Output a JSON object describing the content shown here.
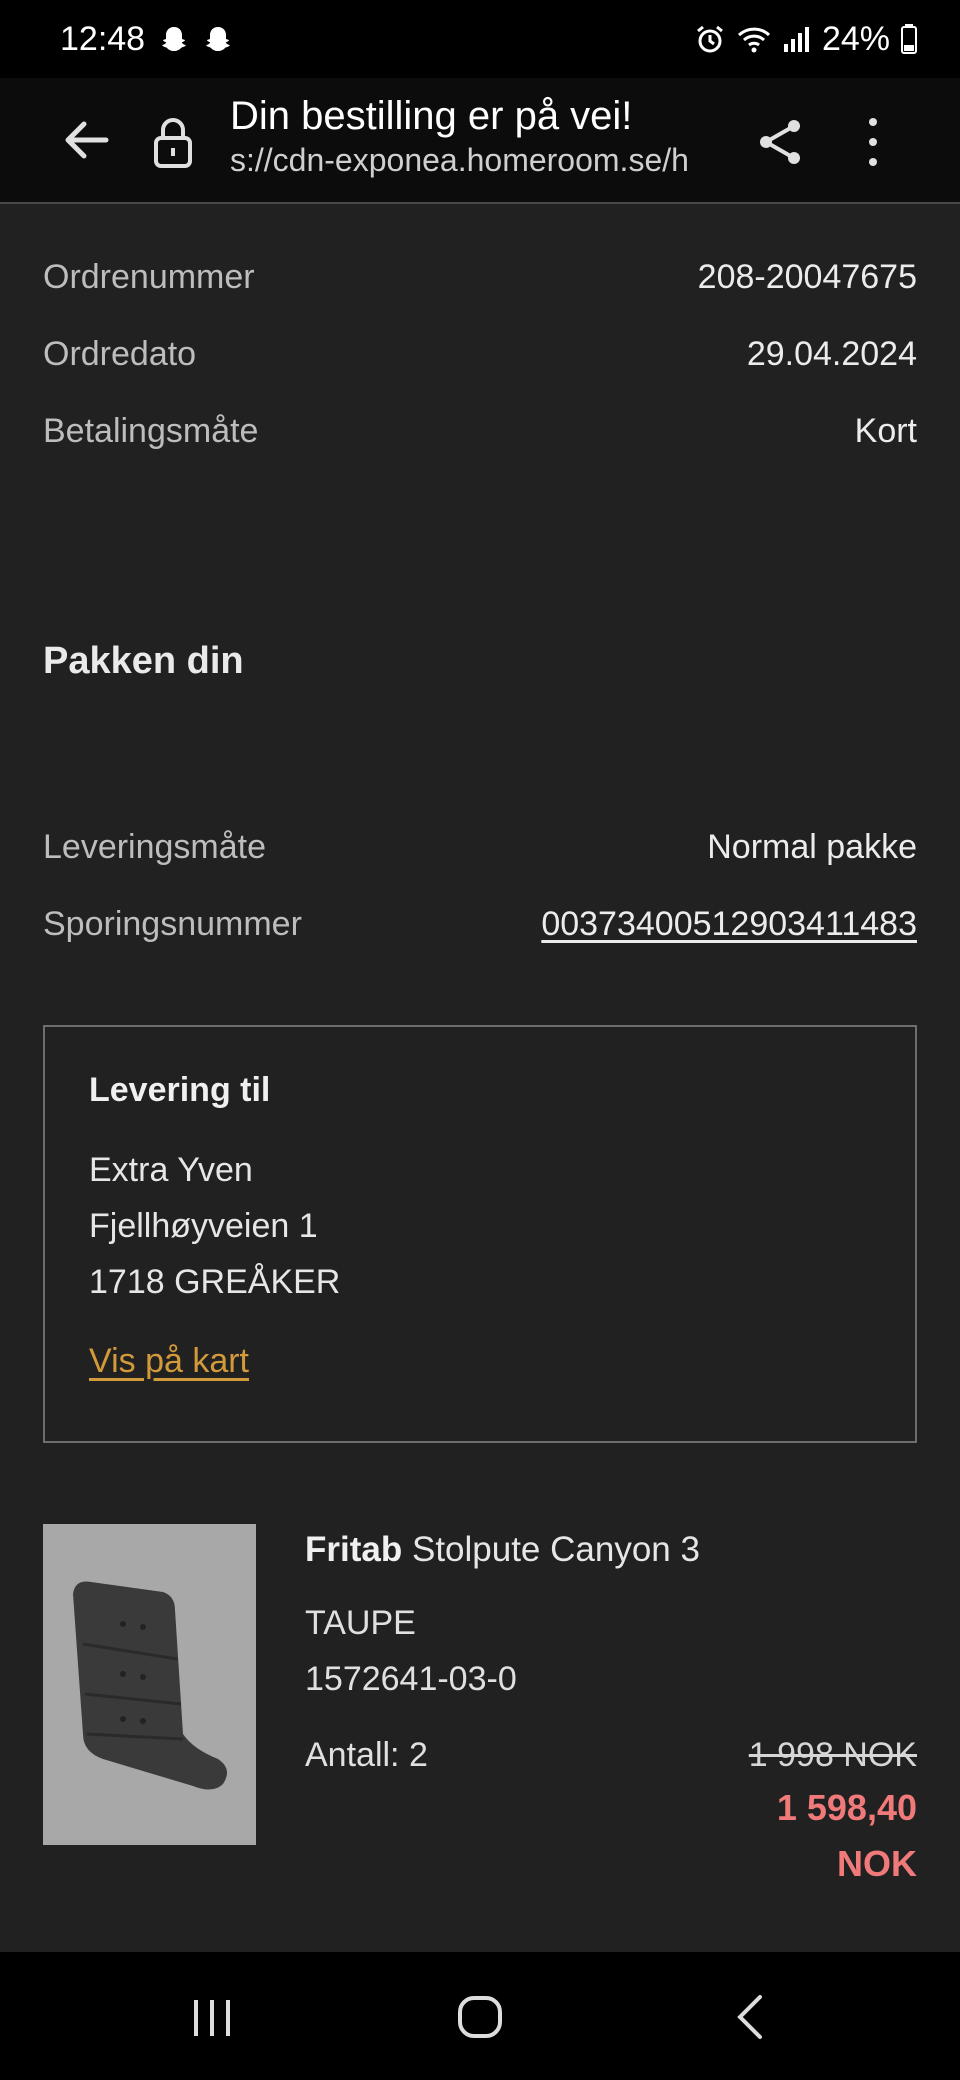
{
  "status_bar": {
    "time": "12:48",
    "battery": "24%",
    "icons": [
      "snapchat-ghost-icon",
      "snapchat-ghost-icon",
      "alarm-icon",
      "wifi-icon",
      "signal-icon",
      "battery-icon"
    ]
  },
  "browser": {
    "page_title": "Din bestilling er på vei!",
    "url": "s://cdn-exponea.homeroom.se/h"
  },
  "order": {
    "rows": [
      {
        "label": "Ordrenummer",
        "value": "208-20047675"
      },
      {
        "label": "Ordredato",
        "value": "29.04.2024"
      },
      {
        "label": "Betalingsmåte",
        "value": "Kort"
      }
    ]
  },
  "package": {
    "title": "Pakken din",
    "delivery_method_label": "Leveringsmåte",
    "delivery_method_value": "Normal pakke",
    "tracking_label": "Sporingsnummer",
    "tracking_value": "00373400512903411483"
  },
  "delivery_address": {
    "heading": "Levering til",
    "name": "Extra Yven",
    "street": "Fjellhøyveien 1",
    "city": "1718 GREÅKER",
    "map_link": "Vis på kart"
  },
  "product": {
    "brand": "Fritab",
    "name": "Stolpute Canyon 3",
    "color": "TAUPE",
    "sku": "1572641-03-0",
    "quantity": "Antall: 2",
    "price_old": "1 998 NOK",
    "price_new": "1 598,40 NOK",
    "colors": {
      "sale": "#f07a7a",
      "link": "#d39a3a"
    }
  }
}
